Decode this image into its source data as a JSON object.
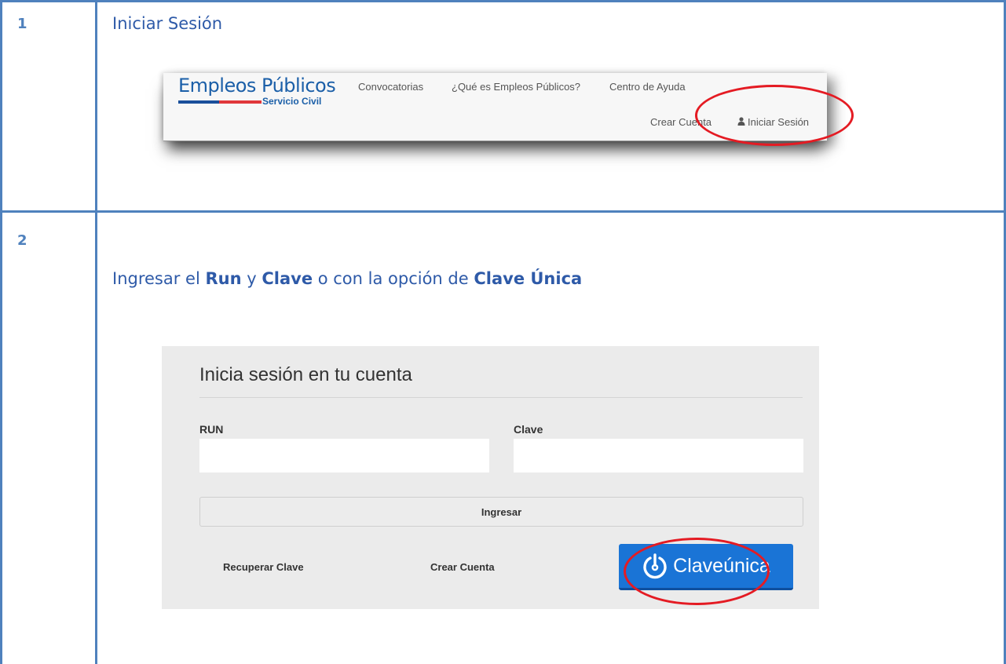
{
  "rows": [
    {
      "number": "1",
      "title": "Iniciar Sesión"
    },
    {
      "number": "2",
      "instruction": {
        "part1": "Ingresar el ",
        "run": "Run",
        "part2": " y ",
        "clave": "Clave",
        "part3": " o con la opción de ",
        "clave_unica": "Clave Única"
      }
    }
  ],
  "header_shot": {
    "brand": "Empleos Públicos",
    "brand_sub": "Servicio Civil",
    "nav": [
      "Convocatorias",
      "¿Qué es Empleos Públicos?",
      "Centro de Ayuda"
    ],
    "crear_cuenta": "Crear Cuenta",
    "iniciar_sesion": "Iniciar Sesión",
    "user_icon": "user-icon"
  },
  "login_shot": {
    "title": "Inicia sesión en tu cuenta",
    "run_label": "RUN",
    "clave_label": "Clave",
    "run_value": "",
    "clave_value": "",
    "ingresar": "Ingresar",
    "recuperar": "Recuperar Clave",
    "crear_cuenta": "Crear Cuenta",
    "clave_unica_button": "Claveúnica",
    "clave_unica_icon": "claveunica-power-icon"
  },
  "colors": {
    "table_border": "#4f81bd",
    "heading_blue": "#2e5aa8",
    "highlight_red": "#e41b23",
    "claveunica_blue": "#1a74d6"
  }
}
